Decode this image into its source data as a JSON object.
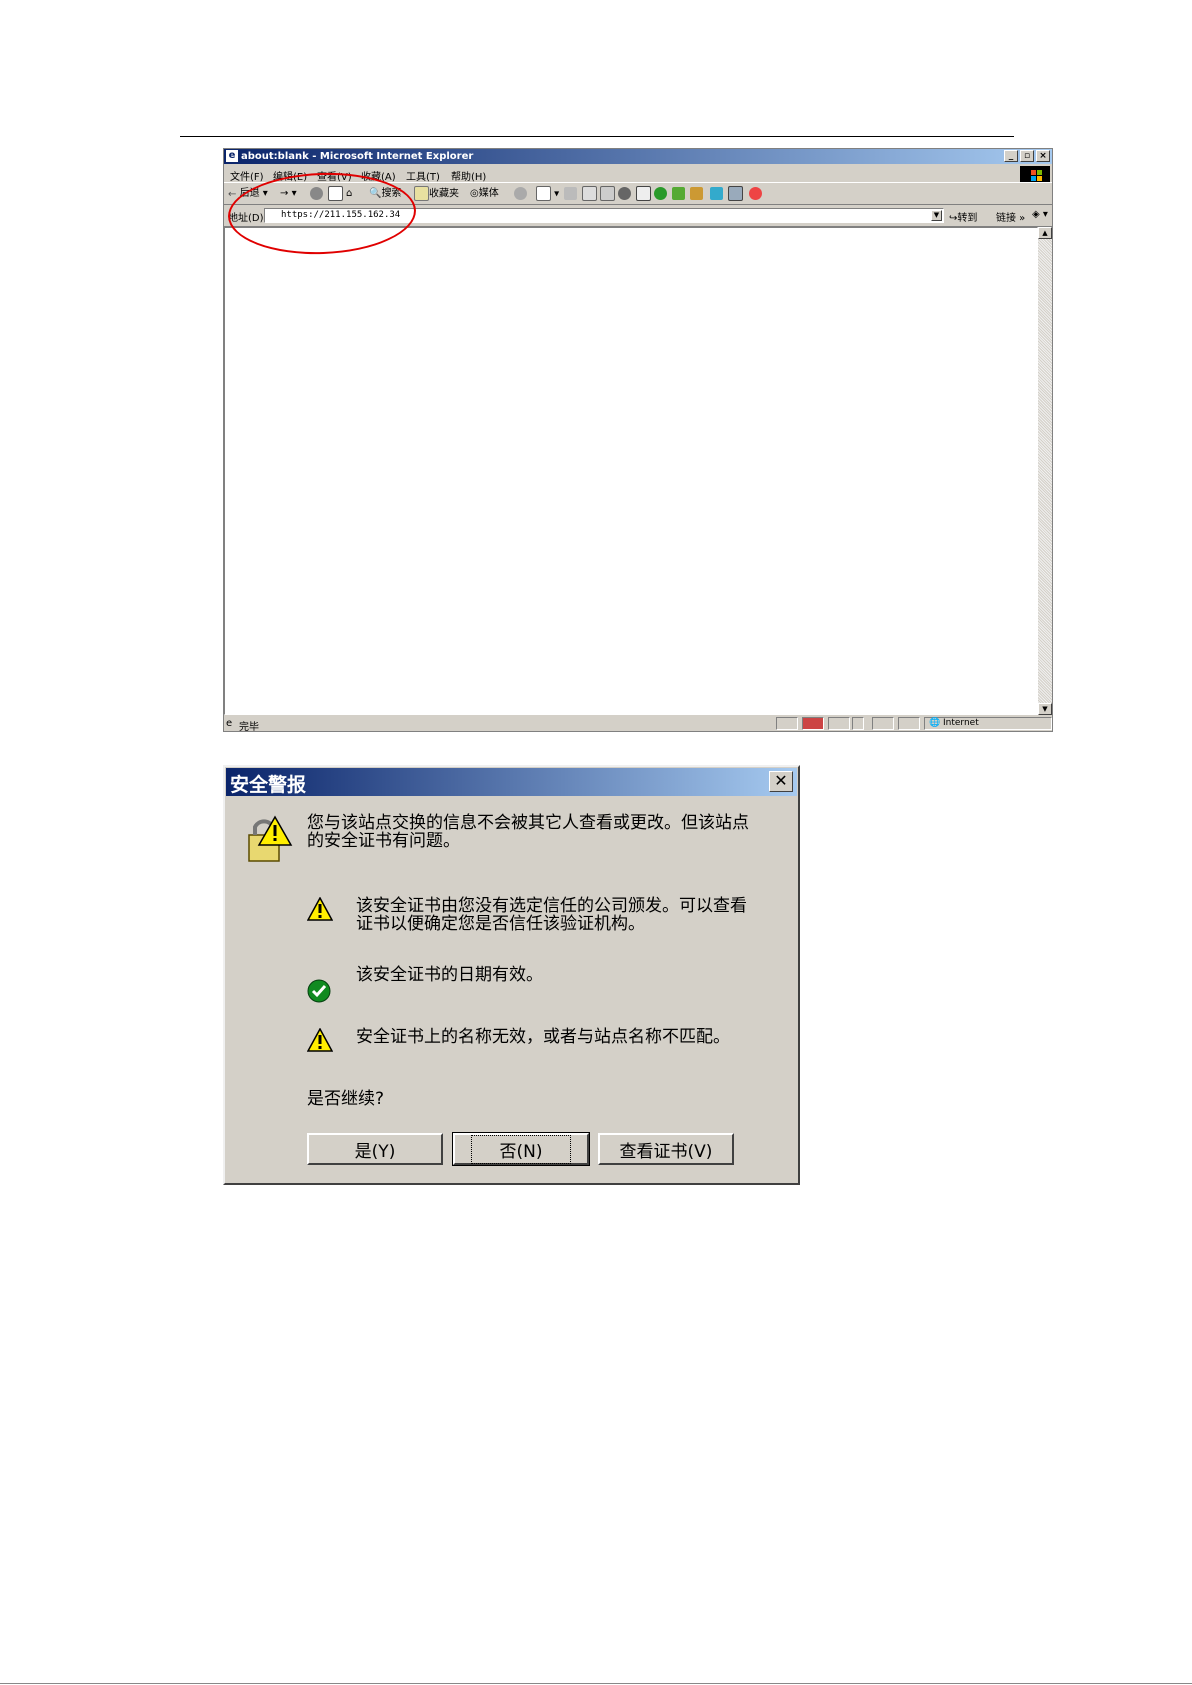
{
  "ie_window": {
    "title": "about:blank - Microsoft Internet Explorer",
    "menu": [
      "文件(F)",
      "编辑(E)",
      "查看(V)",
      "收藏(A)",
      "工具(T)",
      "帮助(H)"
    ],
    "toolbar": {
      "back": "后退",
      "search": "搜索",
      "favorites": "收藏夹",
      "media": "媒体"
    },
    "address": {
      "label": "地址(D)",
      "value": "https://211.155.162.34",
      "go": "转到",
      "links": "链接"
    },
    "status": {
      "text": "完毕",
      "zone": "Internet"
    }
  },
  "dialog": {
    "title": "安全警报",
    "intro_line1": "您与该站点交换的信息不会被其它人查看或更改。但该站点",
    "intro_line2": "的安全证书有问题。",
    "item1_line1": "该安全证书由您没有选定信任的公司颁发。可以查看",
    "item1_line2": "证书以便确定您是否信任该验证机构。",
    "item2": "该安全证书的日期有效。",
    "item3": "安全证书上的名称无效，或者与站点名称不匹配。",
    "question": "是否继续?",
    "buttons": {
      "yes": "是(Y)",
      "no": "否(N)",
      "view": "查看证书(V)"
    }
  }
}
